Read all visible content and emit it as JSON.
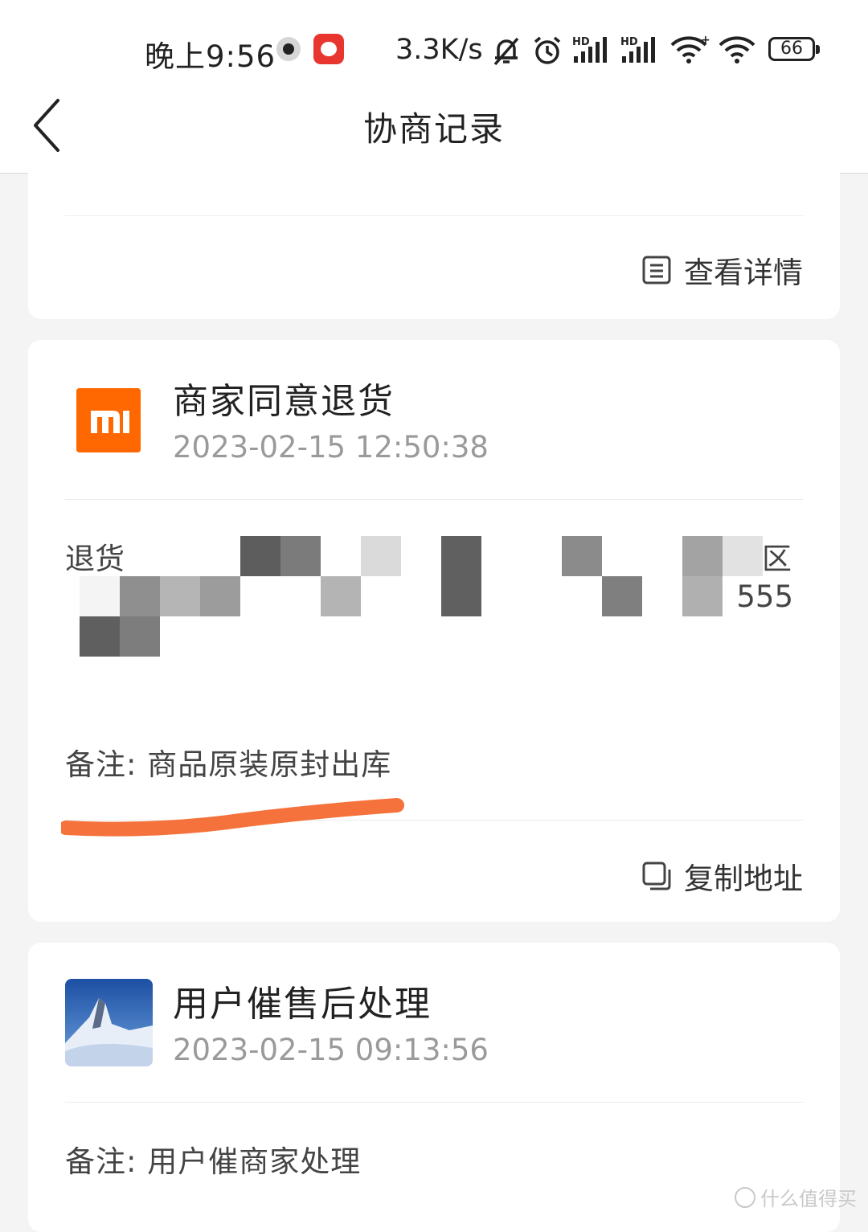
{
  "status_bar": {
    "time": "晚上9:56",
    "network_speed": "3.3K/s",
    "battery": "66",
    "icons": [
      "dot-icon",
      "app-icon",
      "bell-off-icon",
      "alarm-icon",
      "signal-hd-icon",
      "signal-hd-icon",
      "wifi-plus-icon",
      "wifi-icon",
      "battery-icon"
    ]
  },
  "nav": {
    "title": "协商记录",
    "back_icon": "chevron-left-icon"
  },
  "records": [
    {
      "action_label": "查看详情",
      "action_icon": "document-list-icon"
    },
    {
      "title": "商家同意退货",
      "time": "2023-02-15 12:50:38",
      "logo": "mi",
      "logo_color": "#ff6700",
      "address_label": "退货",
      "address_tail_1": "区",
      "address_tail_2": "555",
      "remark": "备注: 商品原装原封出库",
      "highlight_color": "#f5723d",
      "action_label": "复制地址",
      "action_icon": "copy-icon"
    },
    {
      "title": "用户催售后处理",
      "time": "2023-02-15 09:13:56",
      "remark": "备注: 用户催商家处理"
    }
  ],
  "watermark": "什么值得买"
}
